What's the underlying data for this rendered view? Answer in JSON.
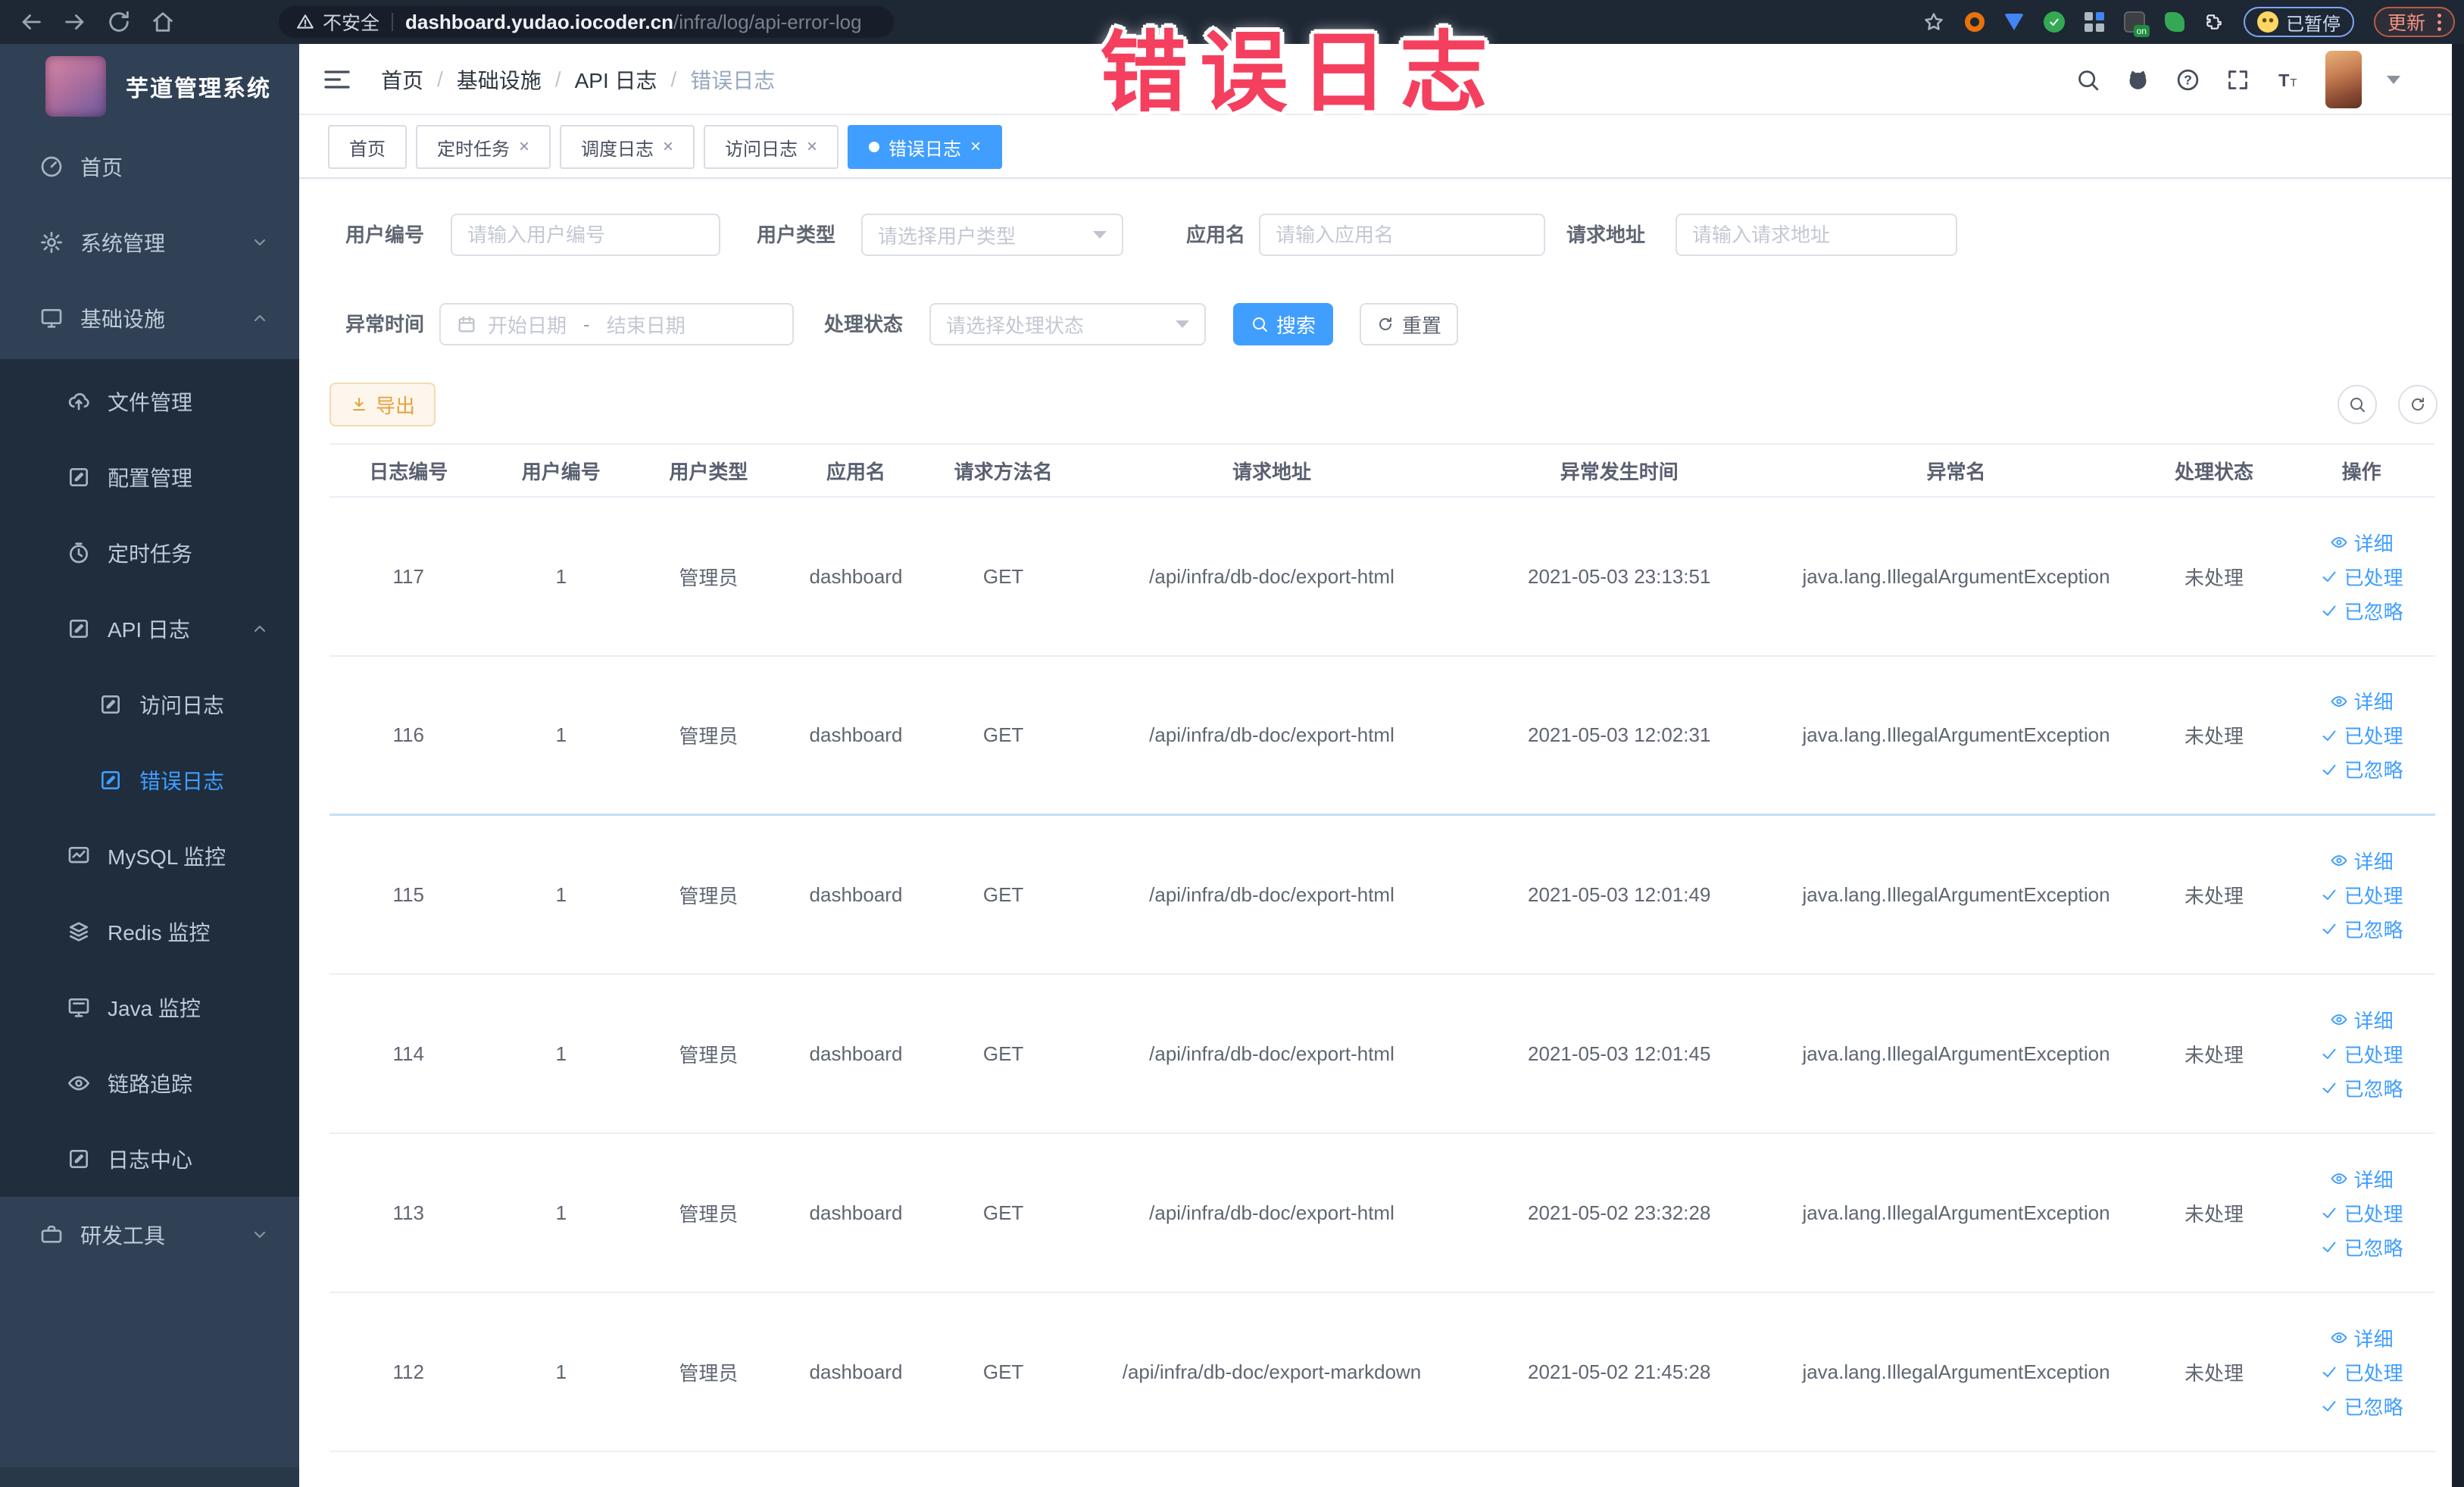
{
  "browser": {
    "security_label": "不安全",
    "url_domain": "dashboard.yudao.iocoder.cn",
    "url_path": "/infra/log/api-error-log",
    "ext_on_badge": "on",
    "paused_badge": "已暂停",
    "update_label": "更新"
  },
  "overlay_title": "错误日志",
  "sidebar": {
    "logo_title": "芋道管理系统",
    "items": [
      {
        "label": "首页"
      },
      {
        "label": "系统管理"
      },
      {
        "label": "基础设施"
      },
      {
        "label": "文件管理"
      },
      {
        "label": "配置管理"
      },
      {
        "label": "定时任务"
      },
      {
        "label": "API 日志"
      },
      {
        "label": "访问日志"
      },
      {
        "label": "错误日志"
      },
      {
        "label": "MySQL 监控"
      },
      {
        "label": "Redis 监控"
      },
      {
        "label": "Java 监控"
      },
      {
        "label": "链路追踪"
      },
      {
        "label": "日志中心"
      },
      {
        "label": "研发工具"
      }
    ]
  },
  "header": {
    "breadcrumb": [
      "首页",
      "基础设施",
      "API 日志",
      "错误日志"
    ]
  },
  "tabs": [
    {
      "label": "首页"
    },
    {
      "label": "定时任务"
    },
    {
      "label": "调度日志"
    },
    {
      "label": "访问日志"
    },
    {
      "label": "错误日志"
    }
  ],
  "filters": {
    "user_id": {
      "label": "用户编号",
      "placeholder": "请输入用户编号"
    },
    "user_type": {
      "label": "用户类型",
      "placeholder": "请选择用户类型"
    },
    "app_name": {
      "label": "应用名",
      "placeholder": "请输入应用名"
    },
    "request_url": {
      "label": "请求地址",
      "placeholder": "请输入请求地址"
    },
    "exception_time": {
      "label": "异常时间",
      "start_placeholder": "开始日期",
      "separator": "-",
      "end_placeholder": "结束日期"
    },
    "process_status": {
      "label": "处理状态",
      "placeholder": "请选择处理状态"
    },
    "search_label": "搜索",
    "reset_label": "重置",
    "export_label": "导出"
  },
  "table": {
    "headers": [
      "日志编号",
      "用户编号",
      "用户类型",
      "应用名",
      "请求方法名",
      "请求地址",
      "异常发生时间",
      "异常名",
      "处理状态",
      "操作"
    ],
    "actions": [
      "详细",
      "已处理",
      "已忽略"
    ],
    "rows": [
      {
        "id": "117",
        "user_id": "1",
        "user_type": "管理员",
        "app": "dashboard",
        "method": "GET",
        "url": "/api/infra/db-doc/export-html",
        "time": "2021-05-03 23:13:51",
        "exception": "java.lang.IllegalArgumentException",
        "status": "未处理"
      },
      {
        "id": "116",
        "user_id": "1",
        "user_type": "管理员",
        "app": "dashboard",
        "method": "GET",
        "url": "/api/infra/db-doc/export-html",
        "time": "2021-05-03 12:02:31",
        "exception": "java.lang.IllegalArgumentException",
        "status": "未处理"
      },
      {
        "id": "115",
        "user_id": "1",
        "user_type": "管理员",
        "app": "dashboard",
        "method": "GET",
        "url": "/api/infra/db-doc/export-html",
        "time": "2021-05-03 12:01:49",
        "exception": "java.lang.IllegalArgumentException",
        "status": "未处理"
      },
      {
        "id": "114",
        "user_id": "1",
        "user_type": "管理员",
        "app": "dashboard",
        "method": "GET",
        "url": "/api/infra/db-doc/export-html",
        "time": "2021-05-03 12:01:45",
        "exception": "java.lang.IllegalArgumentException",
        "status": "未处理"
      },
      {
        "id": "113",
        "user_id": "1",
        "user_type": "管理员",
        "app": "dashboard",
        "method": "GET",
        "url": "/api/infra/db-doc/export-html",
        "time": "2021-05-02 23:32:28",
        "exception": "java.lang.IllegalArgumentException",
        "status": "未处理"
      },
      {
        "id": "112",
        "user_id": "1",
        "user_type": "管理员",
        "app": "dashboard",
        "method": "GET",
        "url": "/api/infra/db-doc/export-markdown",
        "time": "2021-05-02 21:45:28",
        "exception": "java.lang.IllegalArgumentException",
        "status": "未处理"
      }
    ]
  },
  "colors": {
    "accent": "#409eff",
    "warning": "#e6a23c",
    "overlay_pink": "#f43f5e",
    "sidebar": "#304156",
    "submenu": "#1f2d3d"
  }
}
